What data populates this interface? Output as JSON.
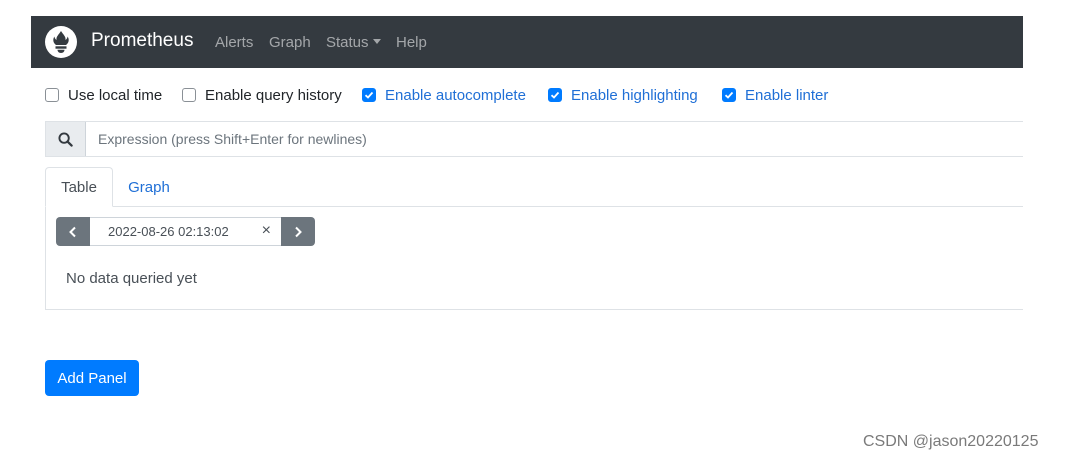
{
  "navbar": {
    "brand": "Prometheus",
    "items": [
      {
        "label": "Alerts"
      },
      {
        "label": "Graph"
      },
      {
        "label": "Status"
      },
      {
        "label": "Help"
      }
    ]
  },
  "options": [
    {
      "label": "Use local time",
      "checked": false
    },
    {
      "label": "Enable query history",
      "checked": false
    },
    {
      "label": "Enable autocomplete",
      "checked": true
    },
    {
      "label": "Enable highlighting",
      "checked": true
    },
    {
      "label": "Enable linter",
      "checked": true
    }
  ],
  "query": {
    "placeholder": "Expression (press Shift+Enter for newlines)",
    "value": ""
  },
  "panel": {
    "tabs": [
      {
        "label": "Table",
        "active": true
      },
      {
        "label": "Graph",
        "active": false
      }
    ],
    "eval_time": "2022-08-26 02:13:02",
    "clear_symbol": "×",
    "empty_message": "No data queried yet"
  },
  "add_panel_label": "Add Panel",
  "watermark": "CSDN @jason20220125",
  "colors": {
    "navbar_bg": "#343a40",
    "primary": "#007bff",
    "secondary": "#6c757d",
    "link": "#1f6fd6"
  }
}
